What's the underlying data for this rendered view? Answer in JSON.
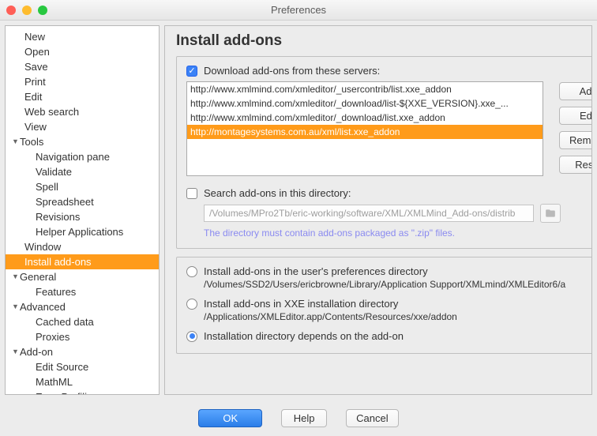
{
  "window": {
    "title": "Preferences"
  },
  "sidebar": {
    "items": [
      {
        "label": "New",
        "kind": "top"
      },
      {
        "label": "Open",
        "kind": "top"
      },
      {
        "label": "Save",
        "kind": "top"
      },
      {
        "label": "Print",
        "kind": "top"
      },
      {
        "label": "Edit",
        "kind": "top"
      },
      {
        "label": "Web search",
        "kind": "top"
      },
      {
        "label": "View",
        "kind": "top"
      },
      {
        "label": "Tools",
        "kind": "group",
        "expanded": true
      },
      {
        "label": "Navigation pane",
        "kind": "child"
      },
      {
        "label": "Validate",
        "kind": "child"
      },
      {
        "label": "Spell",
        "kind": "child"
      },
      {
        "label": "Spreadsheet",
        "kind": "child"
      },
      {
        "label": "Revisions",
        "kind": "child"
      },
      {
        "label": "Helper Applications",
        "kind": "child"
      },
      {
        "label": "Window",
        "kind": "top"
      },
      {
        "label": "Install add-ons",
        "kind": "top",
        "selected": true
      },
      {
        "label": "General",
        "kind": "group",
        "expanded": true
      },
      {
        "label": "Features",
        "kind": "child"
      },
      {
        "label": "Advanced",
        "kind": "group",
        "expanded": true
      },
      {
        "label": "Cached data",
        "kind": "child"
      },
      {
        "label": "Proxies",
        "kind": "child"
      },
      {
        "label": "Add-on",
        "kind": "group",
        "expanded": true
      },
      {
        "label": "Edit Source",
        "kind": "child"
      },
      {
        "label": "MathML",
        "kind": "child"
      },
      {
        "label": "Easy Profiling",
        "kind": "child"
      }
    ]
  },
  "page": {
    "heading": "Install add-ons",
    "download": {
      "check_label": "Download add-ons from these servers:",
      "checked": true,
      "servers": [
        "http://www.xmlmind.com/xmleditor/_usercontrib/list.xxe_addon",
        "http://www.xmlmind.com/xmleditor/_download/list-${XXE_VERSION}.xxe_...",
        "http://www.xmlmind.com/xmleditor/_download/list.xxe_addon",
        "http://montagesystems.com.au/xml/list.xxe_addon"
      ],
      "selected_index": 3,
      "buttons": {
        "add": "Add",
        "edit": "Edit",
        "remove": "Remove",
        "reset": "Reset"
      }
    },
    "search": {
      "check_label": "Search add-ons in this directory:",
      "checked": false,
      "value": "/Volumes/MPro2Tb/eric-working/software/XML/XMLMind_Add-ons/distrib",
      "hint": "The directory must contain add-ons packaged as \".zip\" files."
    },
    "install_location": {
      "options": [
        {
          "label": "Install add-ons in the user's preferences directory",
          "path": "/Volumes/SSD2/Users/ericbrowne/Library/Application Support/XMLmind/XMLEditor6/a",
          "checked": false
        },
        {
          "label": "Install add-ons in XXE installation directory",
          "path": "/Applications/XMLEditor.app/Contents/Resources/xxe/addon",
          "checked": false
        },
        {
          "label": "Installation directory depends on the add-on",
          "path": "",
          "checked": true
        }
      ]
    }
  },
  "footer": {
    "ok": "OK",
    "help": "Help",
    "cancel": "Cancel"
  }
}
